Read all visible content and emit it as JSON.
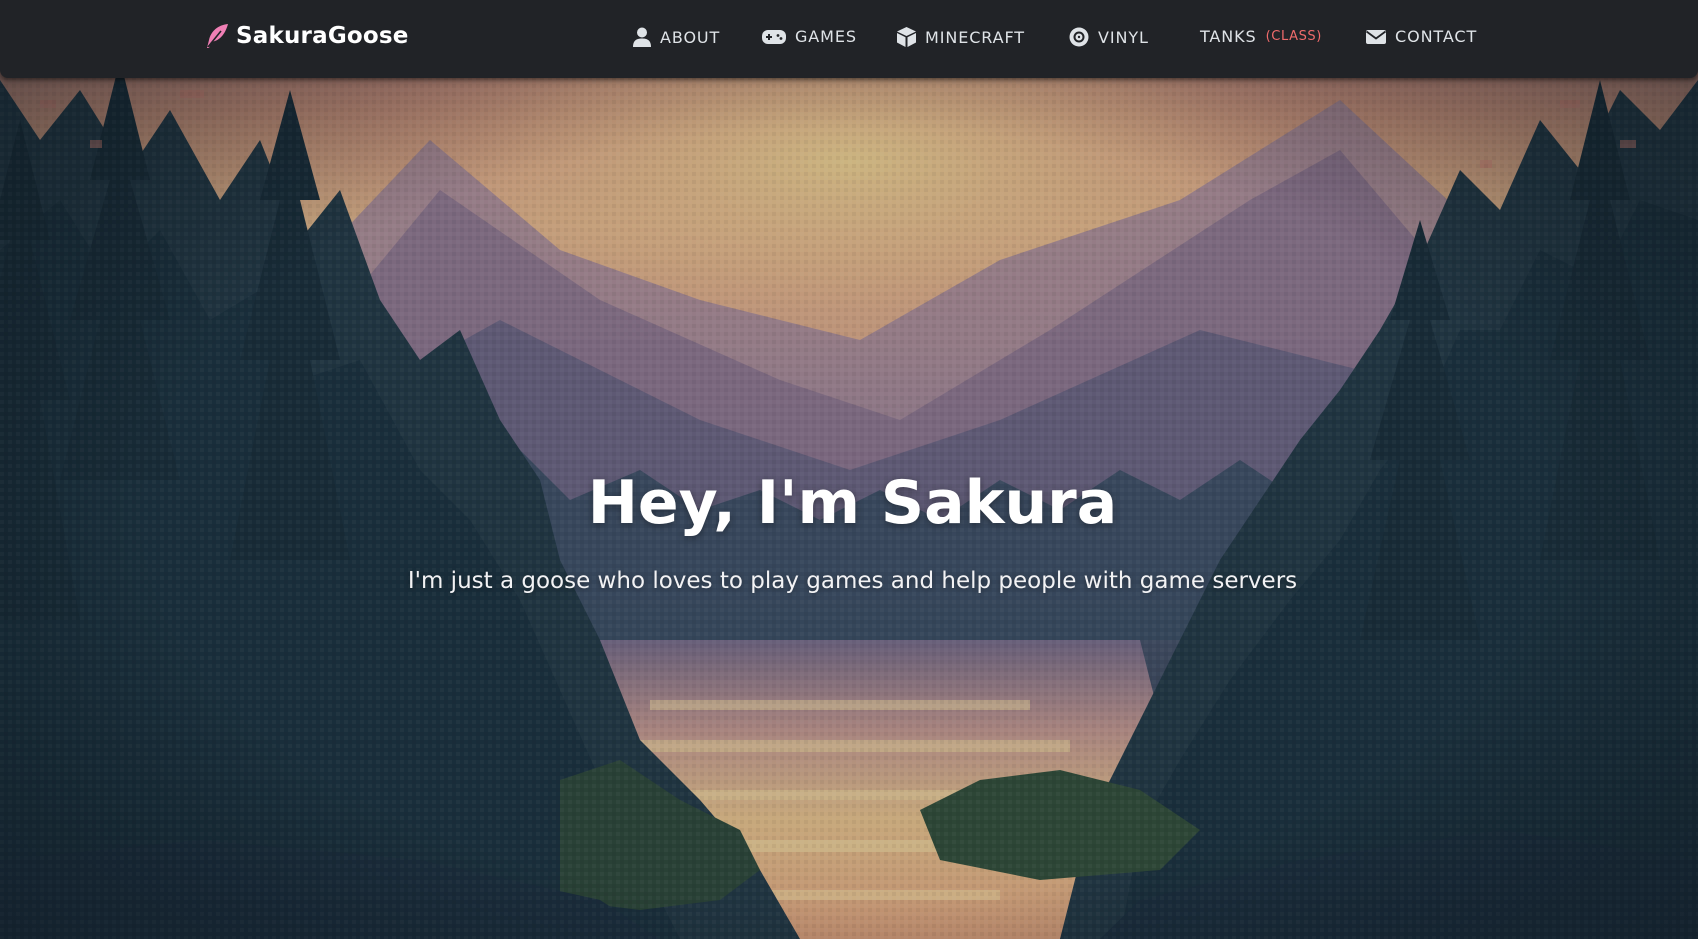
{
  "brand": {
    "name": "SakuraGoose",
    "icon": "feather-icon",
    "icon_color": "#f07fb5"
  },
  "nav": {
    "items": [
      {
        "label": "ABOUT",
        "icon": "user-icon"
      },
      {
        "label": "GAMES",
        "icon": "gamepad-icon"
      },
      {
        "label": "MINECRAFT",
        "icon": "cube-icon"
      },
      {
        "label": "VINYL",
        "icon": "record-icon"
      },
      {
        "label": "TANKS",
        "badge": "(CLASS)",
        "badge_color": "#ef6b6b"
      },
      {
        "label": "CONTACT",
        "icon": "envelope-icon"
      }
    ]
  },
  "hero": {
    "title": "Hey, I'm Sakura",
    "subtitle": "I'm just a goose who loves to play games and help people with game servers",
    "background": "pixel-art-sunset-lake-background"
  },
  "colors": {
    "nav_bg": "#212327",
    "nav_text": "#dfe3e7",
    "sky_top": "#c98a7a",
    "sky_glow": "#f3cf8f",
    "forest": "#1f3a44"
  }
}
